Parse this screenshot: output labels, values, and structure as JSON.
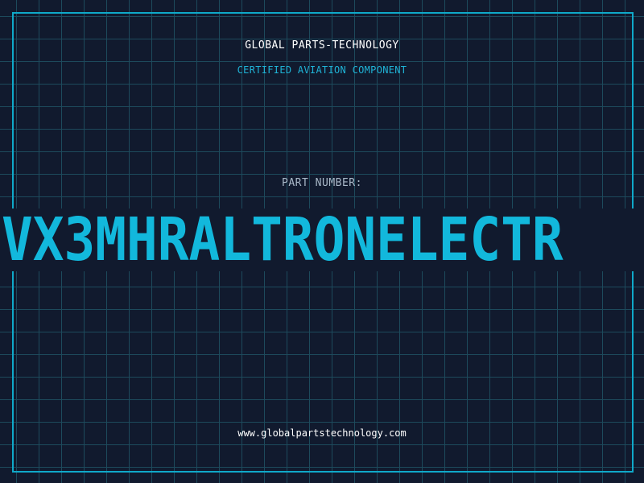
{
  "brand": {
    "title": "GLOBAL PARTS-TECHNOLOGY",
    "subtitle": "CERTIFIED AVIATION COMPONENT"
  },
  "part": {
    "label": "PART NUMBER:",
    "number": "VX3MHRALTRONELECTR"
  },
  "footer": {
    "website": "www.globalpartstechnology.com"
  },
  "colors": {
    "background": "#111a2e",
    "grid": "#1d4a5c",
    "accent": "#12b8dc",
    "frame": "#0fa9c9"
  }
}
